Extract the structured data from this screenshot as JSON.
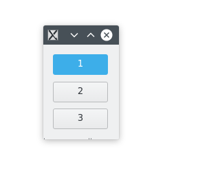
{
  "window": {
    "titlebar": {
      "app_icon": "x-window-icon",
      "minimize_icon": "chevron-down-icon",
      "maximize_icon": "chevron-up-icon",
      "close_icon": "close-icon"
    },
    "buttons": [
      {
        "label": "1",
        "state": "active"
      },
      {
        "label": "2",
        "state": "normal"
      },
      {
        "label": "3",
        "state": "normal"
      }
    ]
  },
  "colors": {
    "titlebar_bg": "#475057",
    "window_bg": "#eff0f1",
    "accent": "#3daee9",
    "text": "#31363b"
  }
}
